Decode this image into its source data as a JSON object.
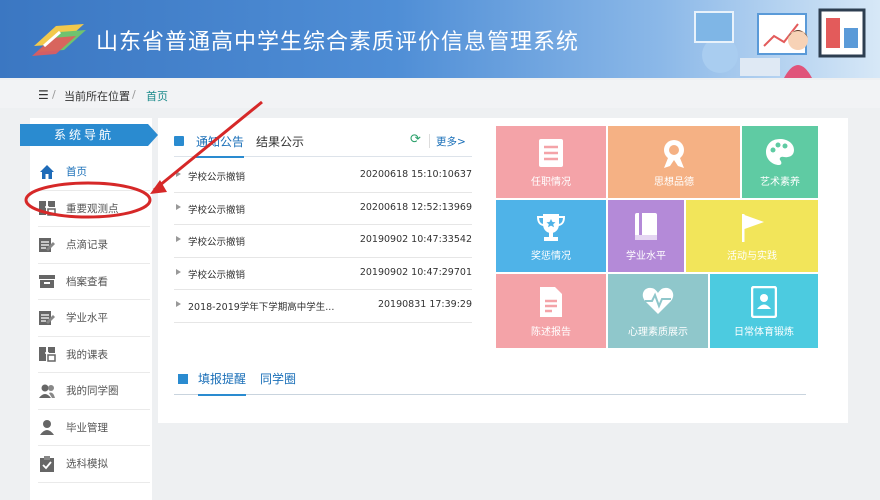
{
  "header": {
    "title": "山东省普通高中学生综合素质评价信息管理系统"
  },
  "breadcrumb": {
    "current_location": "当前所在位置",
    "home": "首页"
  },
  "sidebar": {
    "title": "系统导航",
    "items": [
      {
        "label": "首页",
        "icon": "home-icon"
      },
      {
        "label": "重要观测点",
        "icon": "swap-doc-icon"
      },
      {
        "label": "点滴记录",
        "icon": "edit-icon"
      },
      {
        "label": "档案查看",
        "icon": "archive-icon"
      },
      {
        "label": "学业水平",
        "icon": "edit-icon"
      },
      {
        "label": "我的课表",
        "icon": "swap-doc-icon"
      },
      {
        "label": "我的同学圈",
        "icon": "users-icon"
      },
      {
        "label": "毕业管理",
        "icon": "user-icon"
      },
      {
        "label": "选科模拟",
        "icon": "checklist-icon"
      }
    ]
  },
  "notices": {
    "tab_active": "通知公告",
    "tab_other": "结果公示",
    "more": "更多>",
    "items": [
      {
        "title": "学校公示撤销",
        "date": "20200618 15:10:10637"
      },
      {
        "title": "学校公示撤销",
        "date": "20200618 12:52:13969"
      },
      {
        "title": "学校公示撤销",
        "date": "20190902 10:47:33542"
      },
      {
        "title": "学校公示撤销",
        "date": "20190902 10:47:29701"
      },
      {
        "title": "2018-2019学年下学期高中学生...",
        "date": "20190831 17:39:29"
      }
    ]
  },
  "bottom_tabs": {
    "tab_active": "填报提醒",
    "tab_other": "同学圈"
  },
  "tiles": [
    {
      "label": "任职情况",
      "color": "#f4a3a8",
      "icon": "list-icon"
    },
    {
      "label": "思想品德",
      "color": "#f5b184",
      "icon": "medal-icon"
    },
    {
      "label": "艺术素养",
      "color": "#5fcba3",
      "icon": "palette-icon"
    },
    {
      "label": "奖惩情况",
      "color": "#4fb3e8",
      "icon": "trophy-icon"
    },
    {
      "label": "学业水平",
      "color": "#b48ad8",
      "icon": "book-icon"
    },
    {
      "label": "活动与实践",
      "color": "#f2e55a",
      "icon": "flag-icon"
    },
    {
      "label": "陈述报告",
      "color": "#f4a3a8",
      "icon": "document-icon"
    },
    {
      "label": "心理素质展示",
      "color": "#8fc7cb",
      "icon": "heartbeat-icon"
    },
    {
      "label": "日常体育锻炼",
      "color": "#4ccbe0",
      "icon": "id-card-icon"
    }
  ]
}
